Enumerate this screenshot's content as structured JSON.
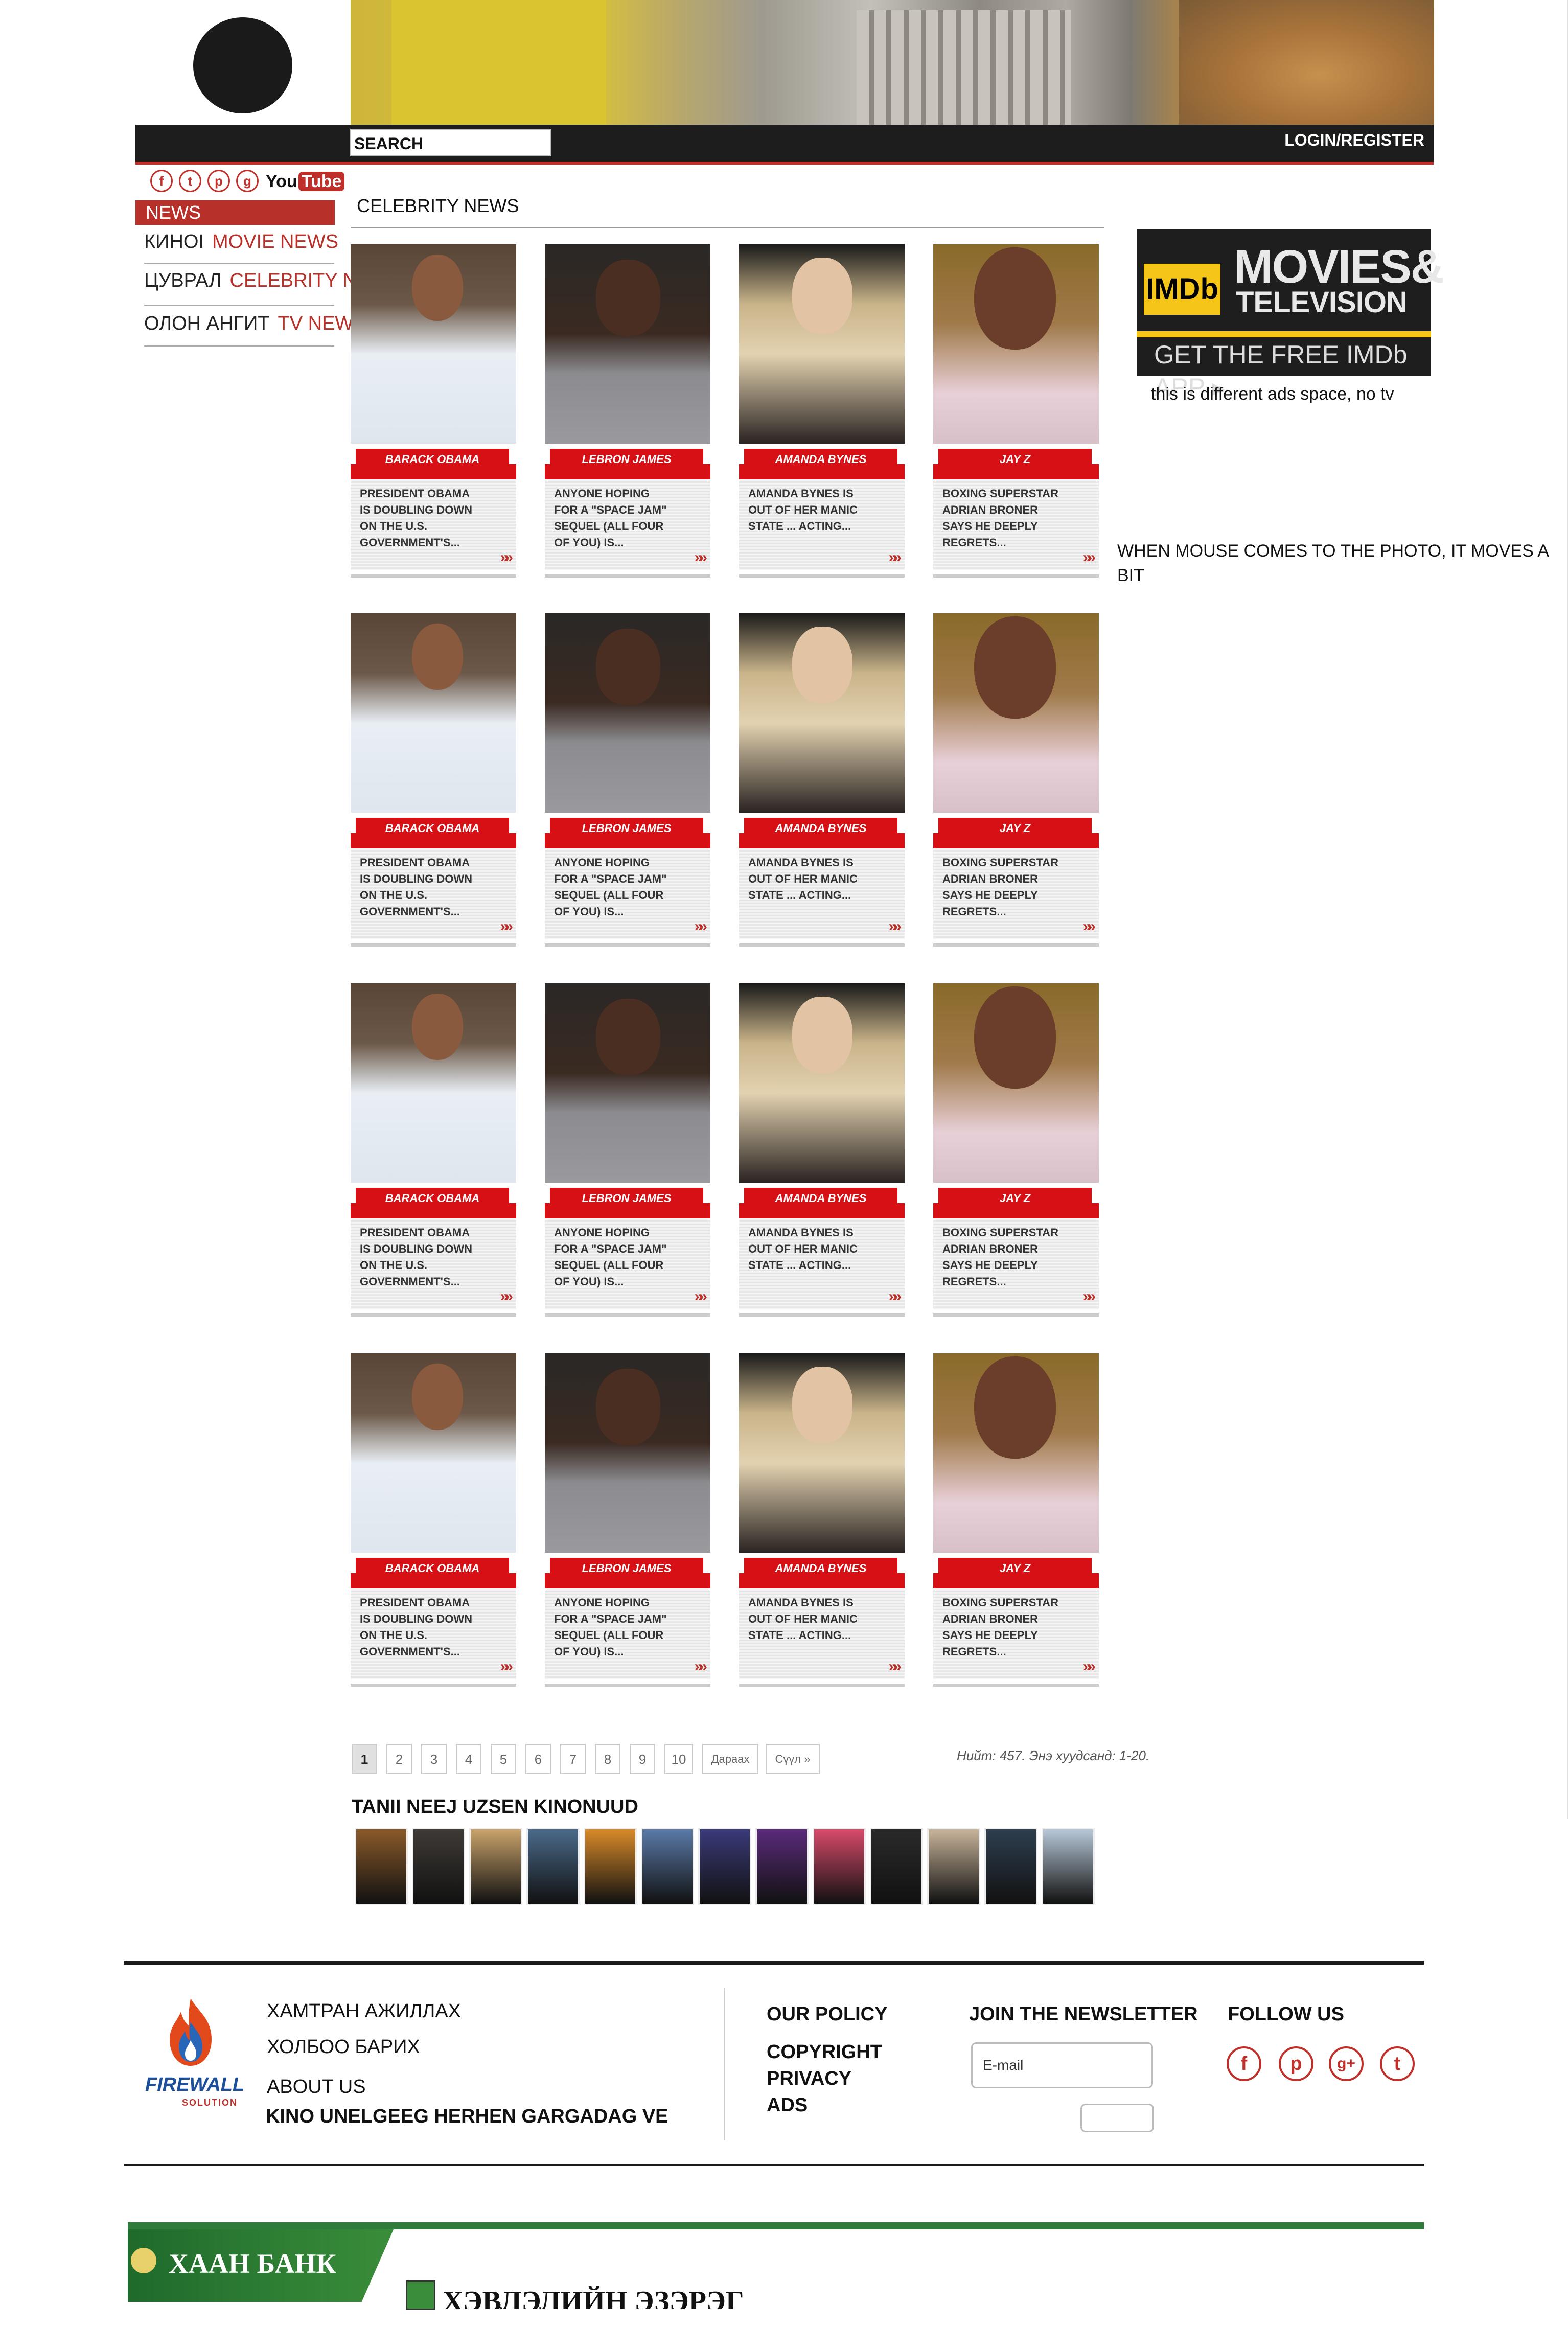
{
  "header": {
    "search_label": "SEARCH",
    "login_label": "LOGIN/REGISTER"
  },
  "sidebar": {
    "social": [
      {
        "icon": "facebook-icon",
        "glyph": "f"
      },
      {
        "icon": "twitter-icon",
        "glyph": "t"
      },
      {
        "icon": "pinterest-icon",
        "glyph": "p"
      },
      {
        "icon": "google-plus-icon",
        "glyph": "g"
      }
    ],
    "youtube": {
      "you": "You",
      "tube": "Tube"
    },
    "news_tab": "NEWS",
    "items": [
      {
        "mn": "КИНОІ",
        "en": "MOVIE NEWS"
      },
      {
        "mn": "ЦУВРАЛ",
        "en": "CELEBRITY NEWS"
      },
      {
        "mn": "ОЛОН АНГИТ",
        "en": "TV NEWS"
      }
    ]
  },
  "main": {
    "section_title": "CELEBRITY NEWS",
    "cards": [
      {
        "name": "BARACK OBAMA",
        "desc": "PRESIDENT OBAMA IS DOUBLING DOWN ON THE U.S. GOVERNMENT'S..."
      },
      {
        "name": "LEBRON JAMES",
        "desc": "ANYONE HOPING FOR A \"SPACE JAM\" SEQUEL (ALL FOUR OF YOU) IS..."
      },
      {
        "name": "AMANDA BYNES",
        "desc": "AMANDA BYNES IS OUT OF HER MANIC STATE ... ACTING..."
      },
      {
        "name": "JAY Z",
        "desc": "BOXING SUPERSTAR ADRIAN BRONER SAYS HE DEEPLY REGRETS..."
      }
    ],
    "more_glyph": "»»"
  },
  "pagination": {
    "pages": [
      "1",
      "2",
      "3",
      "4",
      "5",
      "6",
      "7",
      "8",
      "9",
      "10"
    ],
    "next": "Дараах",
    "last": "Сүүл »",
    "total": "Нийт: 457. Энэ хуудсанд: 1-20."
  },
  "watched": {
    "title": "TANII NEEJ UZSEN KINONUUD",
    "poster_colors": [
      "#8a5a2a",
      "#3e3a36",
      "#c9a36a",
      "#4a6a8a",
      "#d98a2a",
      "#5a7aa8",
      "#3a3a7a",
      "#5a2a7a",
      "#d84a6a",
      "#2a2a2a",
      "#c8b49a",
      "#2e3e4e",
      "#b8c8d8"
    ]
  },
  "right": {
    "imdb": {
      "logo": "IMDb",
      "movies": "MOVIES&",
      "tv": "TELEVISION",
      "get": "GET THE FREE IMDb APP ▸"
    },
    "ad_note": "this is different ads space, no tv",
    "hover_note": "WHEN MOUSE COMES TO THE PHOTO, IT MOVES A BIT"
  },
  "footer": {
    "brand": {
      "name": "FIREWALL",
      "sub": "SOLUTION"
    },
    "links": [
      "ХАМТРАН АЖИЛЛАХ",
      "ХОЛБОО БАРИХ",
      "ABOUT US",
      "KINO UNELGEEG HERHEN GARGADAG VE"
    ],
    "policy_title": "OUR POLICY",
    "policy_items": [
      "COPYRIGHT",
      "PRIVACY",
      "ADS"
    ],
    "newsletter_title": "JOIN THE NEWSLETTER",
    "email_placeholder": "E-mail",
    "follow_title": "FOLLOW US",
    "follow_icons": [
      {
        "icon": "facebook-icon",
        "glyph": "f"
      },
      {
        "icon": "pinterest-icon",
        "glyph": "p"
      },
      {
        "icon": "google-plus-icon",
        "glyph": "g+"
      },
      {
        "icon": "twitter-icon",
        "glyph": "t"
      }
    ]
  },
  "bottom_ad": {
    "khaan": "ХААН БАНК",
    "hev": "ХЭВЛЭЛИЙН ЭЗЭРЭГ"
  }
}
